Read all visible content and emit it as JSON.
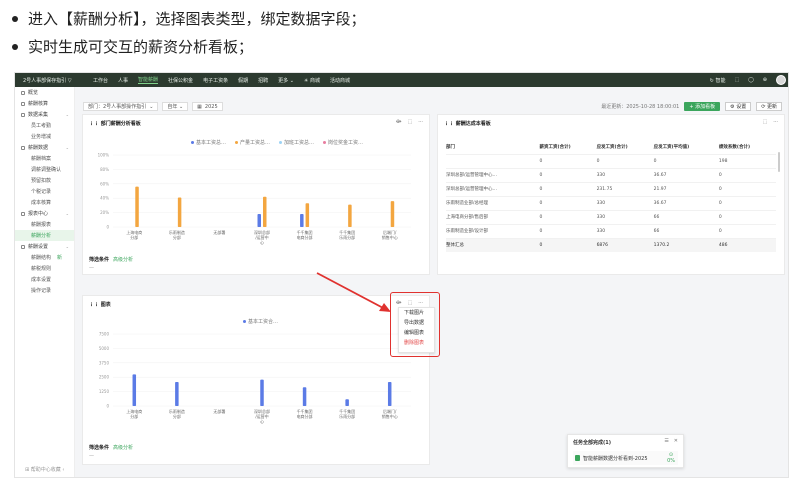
{
  "bullets": [
    "进入【薪酬分析】，选择图表类型，绑定数据字段；",
    "实时生成可交互的薪资分析看板；"
  ],
  "topbar": {
    "logo": "2号人事部保存指引 ▽",
    "nav": [
      "工作台",
      "人事",
      "智能薪酬",
      "社保公积金",
      "电子工资条",
      "假期",
      "招聘",
      "更多 ⌄",
      "☀ 商城",
      "活动商城"
    ],
    "nav_active": 2,
    "right": [
      "↻ 智能",
      "⬚",
      "◯",
      "⊕"
    ]
  },
  "sidebar": {
    "items": [
      {
        "label": "概览",
        "type": "top"
      },
      {
        "label": "薪酬核算",
        "type": "top"
      },
      {
        "label": "数据采集",
        "type": "top",
        "chev": "⌄"
      },
      {
        "label": "员工考勤",
        "type": "sub"
      },
      {
        "label": "业务增减",
        "type": "sub"
      },
      {
        "label": "薪酬数据",
        "type": "top",
        "chev": "⌄"
      },
      {
        "label": "薪酬档案",
        "type": "sub"
      },
      {
        "label": "调薪调整确认",
        "type": "sub"
      },
      {
        "label": "预留扣款",
        "type": "sub"
      },
      {
        "label": "个税记录",
        "type": "sub"
      },
      {
        "label": "成本核算",
        "type": "sub"
      },
      {
        "label": "报表中心",
        "type": "top",
        "chev": "⌄"
      },
      {
        "label": "薪酬报表",
        "type": "sub"
      },
      {
        "label": "薪酬分析",
        "type": "sub",
        "active": true
      },
      {
        "label": "薪酬设置",
        "type": "top",
        "chev": "⌄"
      },
      {
        "label": "薪酬结构",
        "type": "sub",
        "badge": "新"
      },
      {
        "label": "薪税规则",
        "type": "sub"
      },
      {
        "label": "成本设置",
        "type": "sub"
      },
      {
        "label": "操作记录",
        "type": "sub"
      }
    ],
    "footer": "⊞ 帮助中心收藏 ‹"
  },
  "filters": {
    "dept": "部门：2号人事部操作指引",
    "period": "自年 ⌄",
    "date": "2025"
  },
  "actions": {
    "updated": "最近更新：2025-10-28 18:00:01",
    "add": "+ 添加看板",
    "settings": "⚙ 设置",
    "refresh": "⟳ 更新"
  },
  "card1": {
    "title": "部门薪酬分析看板",
    "icons": [
      "⟴",
      "⬚",
      "···"
    ],
    "legend": [
      "基本工资总…",
      "产量工资总…",
      "加班工资总…",
      "岗位奖金工资…"
    ],
    "legend_colors": [
      "#5b7be6",
      "#f3a640",
      "#9dd3f5",
      "#e87da0"
    ],
    "footer_label": "筛选条件",
    "footer_tag": "高级分析",
    "footer_dash": "—"
  },
  "card2": {
    "title": "薪酬达成本看板",
    "icons": [
      "⬚",
      "···"
    ],
    "columns": [
      "部门",
      "薪资工资(合计)",
      "应发工资(合计)",
      "应发工资(平均值)",
      "绩效系数(合计)"
    ],
    "rows": [
      [
        "",
        "0",
        "0",
        "0",
        "198"
      ],
      [
        "深圳总部/运营管理中心…",
        "0",
        "330",
        "36.67",
        "0"
      ],
      [
        "深圳总部/运营管理中心…",
        "0",
        "231.75",
        "21.97",
        "0"
      ],
      [
        "乐雨制造业部/总经理",
        "0",
        "330",
        "36.67",
        "0"
      ],
      [
        "上海电商分部/售后部",
        "0",
        "330",
        "66",
        "0"
      ],
      [
        "乐雨制造业部/设计部",
        "0",
        "330",
        "66",
        "0"
      ]
    ],
    "total": [
      "整体汇总",
      "0",
      "6876",
      "1370.2",
      "486"
    ],
    "footer_label": "筛选条件",
    "footer_tag": "高级分析",
    "footer_dash": "—"
  },
  "card3": {
    "title": "图表",
    "icons": [
      "⟴",
      "⬚",
      "···"
    ],
    "legend": [
      "基本工资合…"
    ],
    "legend_colors": [
      "#5b7be6"
    ],
    "footer_label": "筛选条件",
    "footer_tag": "高级分析",
    "footer_dash": "—"
  },
  "menu": [
    "下载图片",
    "导出数据",
    "编辑图表",
    "删除图表"
  ],
  "toast": {
    "title": "任务全部完成(1)",
    "icons": [
      "☰",
      "✕"
    ],
    "file": "智能薪酬数据分析看到-2025",
    "pct": "⊙\n0%"
  },
  "chart_data": [
    {
      "type": "bar",
      "categories": [
        "上海电商分部",
        "乐雨制造分部",
        "无部署",
        "深圳总部/运营中心",
        "千千集团电商分部",
        "千千集团乐雨分部",
        "后端门/销售中心"
      ],
      "series": [
        {
          "name": "基本工资总…",
          "values": [
            0,
            0,
            0,
            180,
            180,
            0,
            0
          ]
        },
        {
          "name": "产量工资总…",
          "values": [
            560,
            410,
            0,
            420,
            330,
            310,
            360
          ]
        }
      ],
      "yticks": [
        "100%",
        "80%",
        "60%",
        "40%",
        "20%",
        "0"
      ],
      "ylim": [
        0,
        1000
      ]
    },
    {
      "type": "bar",
      "categories": [
        "上海电商分部",
        "乐雨制造分部",
        "无部署",
        "深圳总部/运营中心",
        "千千集团电商分部",
        "千千集团乐雨分部",
        "后端门/销售中心"
      ],
      "series": [
        {
          "name": "基本工资合…",
          "values": [
            3300,
            2500,
            0,
            2750,
            1950,
            700,
            2500
          ]
        }
      ],
      "yticks": [
        "7500",
        "5000",
        "3750",
        "2500",
        "1250",
        "0"
      ],
      "ylim": [
        0,
        7500
      ]
    }
  ]
}
